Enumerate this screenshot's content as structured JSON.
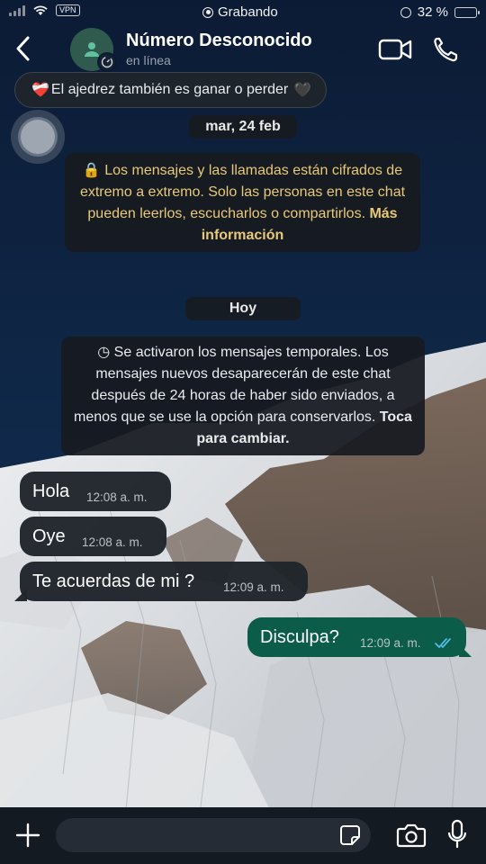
{
  "status_bar": {
    "recording_label": "Grabando",
    "vpn_label": "VPN",
    "battery_percent": "32 %",
    "battery_level": 0.32
  },
  "header": {
    "contact_name": "Número Desconocido",
    "contact_status": "en línea"
  },
  "note": {
    "emoji_left": "❤️‍🩹",
    "text": "El ajedrez también es ganar o perder",
    "emoji_right": "🖤"
  },
  "date_label": "mar, 24 feb",
  "encryption_notice": {
    "text": "🔒 Los mensajes y las llamadas están cifrados de extremo a extremo. Solo las personas en este chat pueden leerlos, escucharlos o compartirlos. ",
    "link": "Más información"
  },
  "today_label": "Hoy",
  "temporary_notice": {
    "text": "◷ Se activaron los mensajes temporales. Los mensajes nuevos desaparecerán de este chat después de 24 horas de haber sido enviados, a menos que se use la opción para conservarlos. ",
    "action": "Toca para cambiar."
  },
  "messages": [
    {
      "direction": "in",
      "text": "Hola",
      "time": "12:08 a. m."
    },
    {
      "direction": "in",
      "text": "Oye",
      "time": "12:08 a. m."
    },
    {
      "direction": "in",
      "text": "Te acuerdas de mi ?",
      "time": "12:09 a. m."
    },
    {
      "direction": "out",
      "text": "Disculpa?",
      "time": "12:09 a. m.",
      "status": "read"
    }
  ],
  "input": {
    "placeholder": ""
  },
  "colors": {
    "outgoing_bubble": "#0b5c49",
    "incoming_bubble": "#20252b",
    "read_ticks": "#53bdeb",
    "encryption_text": "#e8c97a"
  }
}
